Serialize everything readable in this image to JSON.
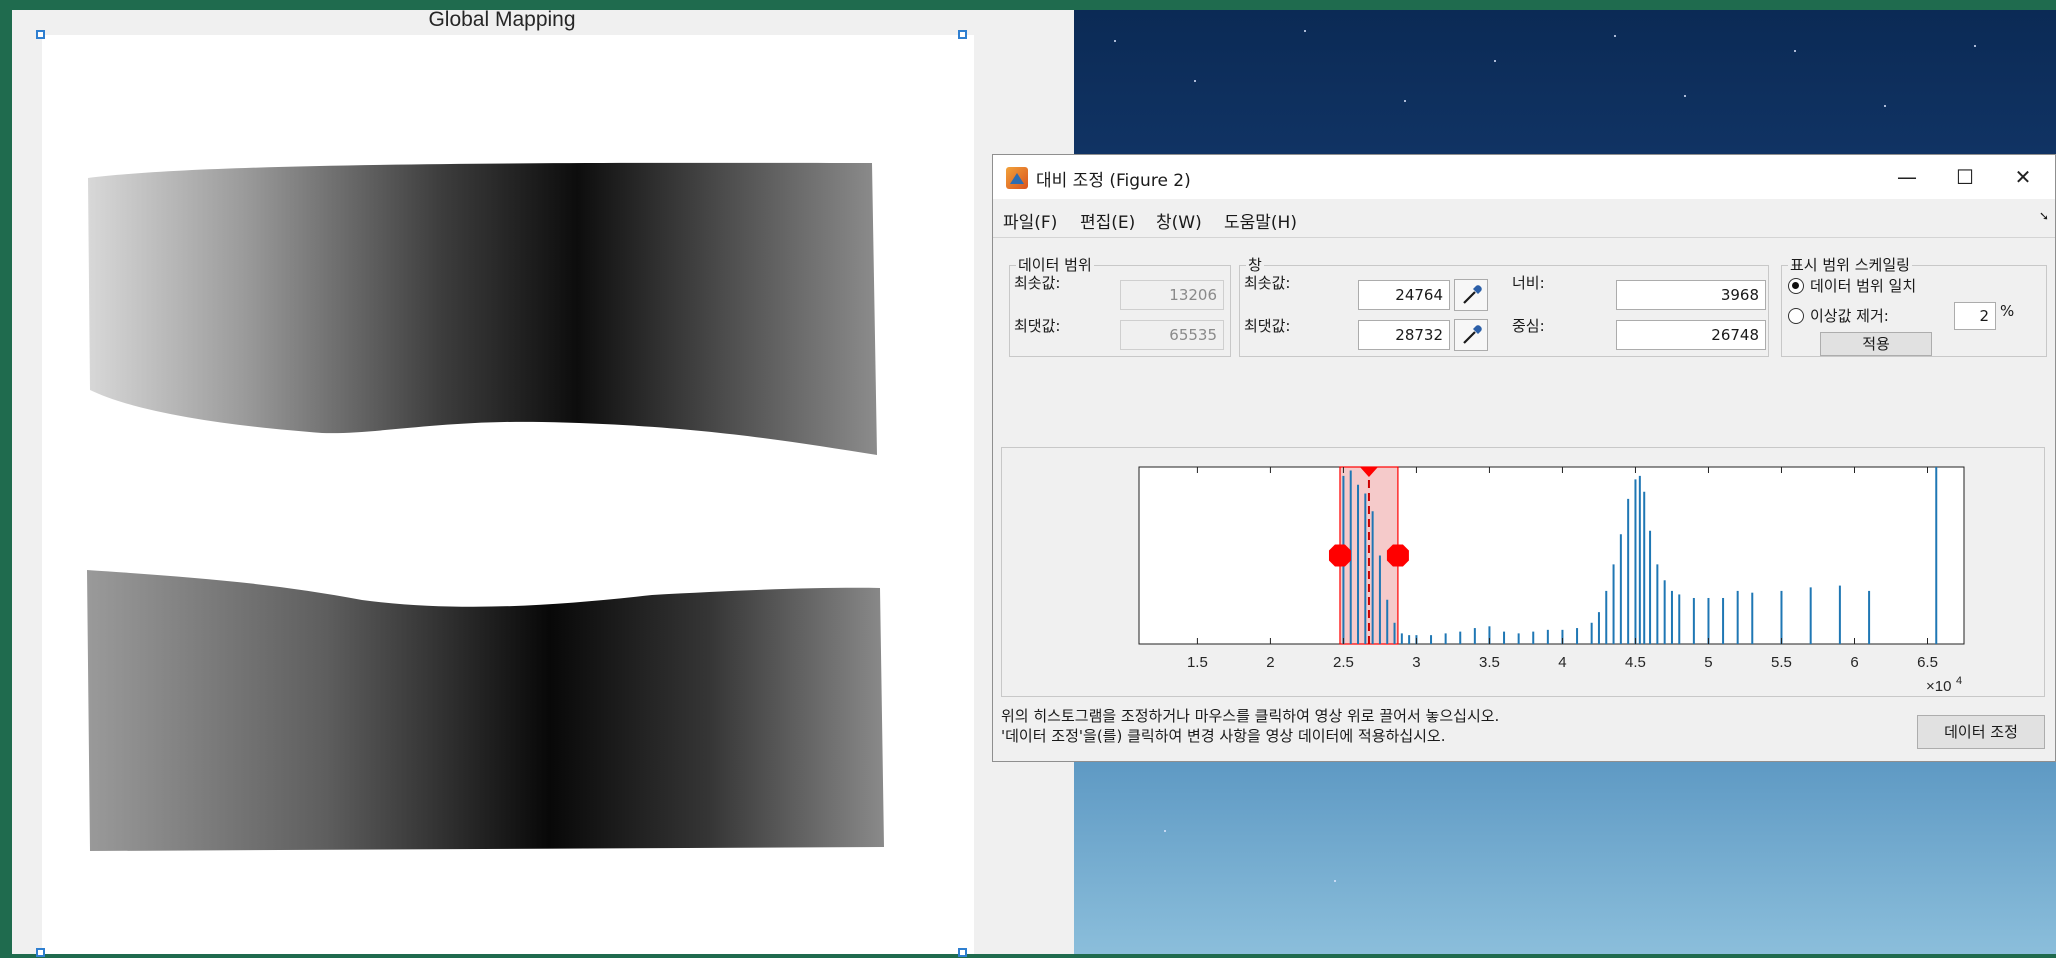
{
  "figure": {
    "title": "Global Mapping"
  },
  "dialog": {
    "title": "대비 조정 (Figure 2)",
    "window_controls": {
      "minimize": "—",
      "maximize": "☐",
      "close": "✕"
    },
    "menu": [
      "파일(F)",
      "편집(E)",
      "창(W)",
      "도움말(H)"
    ],
    "data_range": {
      "title": "데이터 범위",
      "min_label": "최솟값:",
      "min_value": "13206",
      "max_label": "최댓값:",
      "max_value": "65535"
    },
    "window": {
      "title": "창",
      "min_label": "최솟값:",
      "min_value": "24764",
      "max_label": "최댓값:",
      "max_value": "28732",
      "width_label": "너비:",
      "width_value": "3968",
      "center_label": "중심:",
      "center_value": "26748"
    },
    "scaling": {
      "title": "표시 범위 스케일링",
      "option_match": "데이터 범위 일치",
      "option_outlier": "이상값 제거:",
      "outlier_percent": "2",
      "percent_sign": "%",
      "apply_label": "적용",
      "selected": "match"
    },
    "footer": {
      "line1": "위의 히스토그램을 조정하거나 마우스를 클릭하여 영상 위로 끌어서 놓으십시오.",
      "line2": "'데이터 조정'을(를) 클릭하여 변경 사항을 영상 데이터에 적용하십시오.",
      "adjust_button": "데이터 조정"
    },
    "colors": {
      "histogram": "#1f77b4",
      "window_fill": "#f2b8b8",
      "handle": "#ff0000"
    }
  },
  "chart_data": {
    "type": "bar",
    "title": "",
    "xlabel": "",
    "ylabel": "",
    "x_tick_labels": [
      "1.5",
      "2",
      "2.5",
      "3",
      "3.5",
      "4",
      "4.5",
      "5",
      "5.5",
      "6",
      "6.5"
    ],
    "x_ticks": [
      15000,
      20000,
      25000,
      30000,
      35000,
      40000,
      45000,
      50000,
      55000,
      60000,
      65000
    ],
    "x_multiplier_label": "×10",
    "x_multiplier_exp": "4",
    "xlim": [
      11000,
      67500
    ],
    "ylim": [
      0,
      1
    ],
    "window_min": 24764,
    "window_max": 28732,
    "window_center": 26748,
    "series": [
      {
        "x": [
          25000,
          25500,
          26000,
          26500,
          27000,
          27500,
          28000,
          28500,
          29000,
          29500,
          30000,
          31000,
          32000,
          33000,
          34000,
          35000,
          36000,
          37000,
          38000,
          39000,
          40000,
          41000,
          42000,
          42500,
          43000,
          43500,
          44000,
          44500,
          45000,
          45300,
          45600,
          46000,
          46500,
          47000,
          47500,
          48000,
          49000,
          50000,
          51000,
          52000,
          53000,
          55000,
          57000,
          59000,
          61000,
          65600
        ],
        "values": [
          0.95,
          0.98,
          0.9,
          0.85,
          0.75,
          0.5,
          0.25,
          0.12,
          0.06,
          0.05,
          0.05,
          0.05,
          0.06,
          0.07,
          0.09,
          0.1,
          0.07,
          0.06,
          0.07,
          0.08,
          0.08,
          0.09,
          0.12,
          0.18,
          0.3,
          0.45,
          0.62,
          0.82,
          0.93,
          0.95,
          0.86,
          0.64,
          0.45,
          0.36,
          0.3,
          0.28,
          0.26,
          0.26,
          0.26,
          0.3,
          0.29,
          0.3,
          0.32,
          0.33,
          0.3,
          1.0
        ]
      }
    ]
  }
}
